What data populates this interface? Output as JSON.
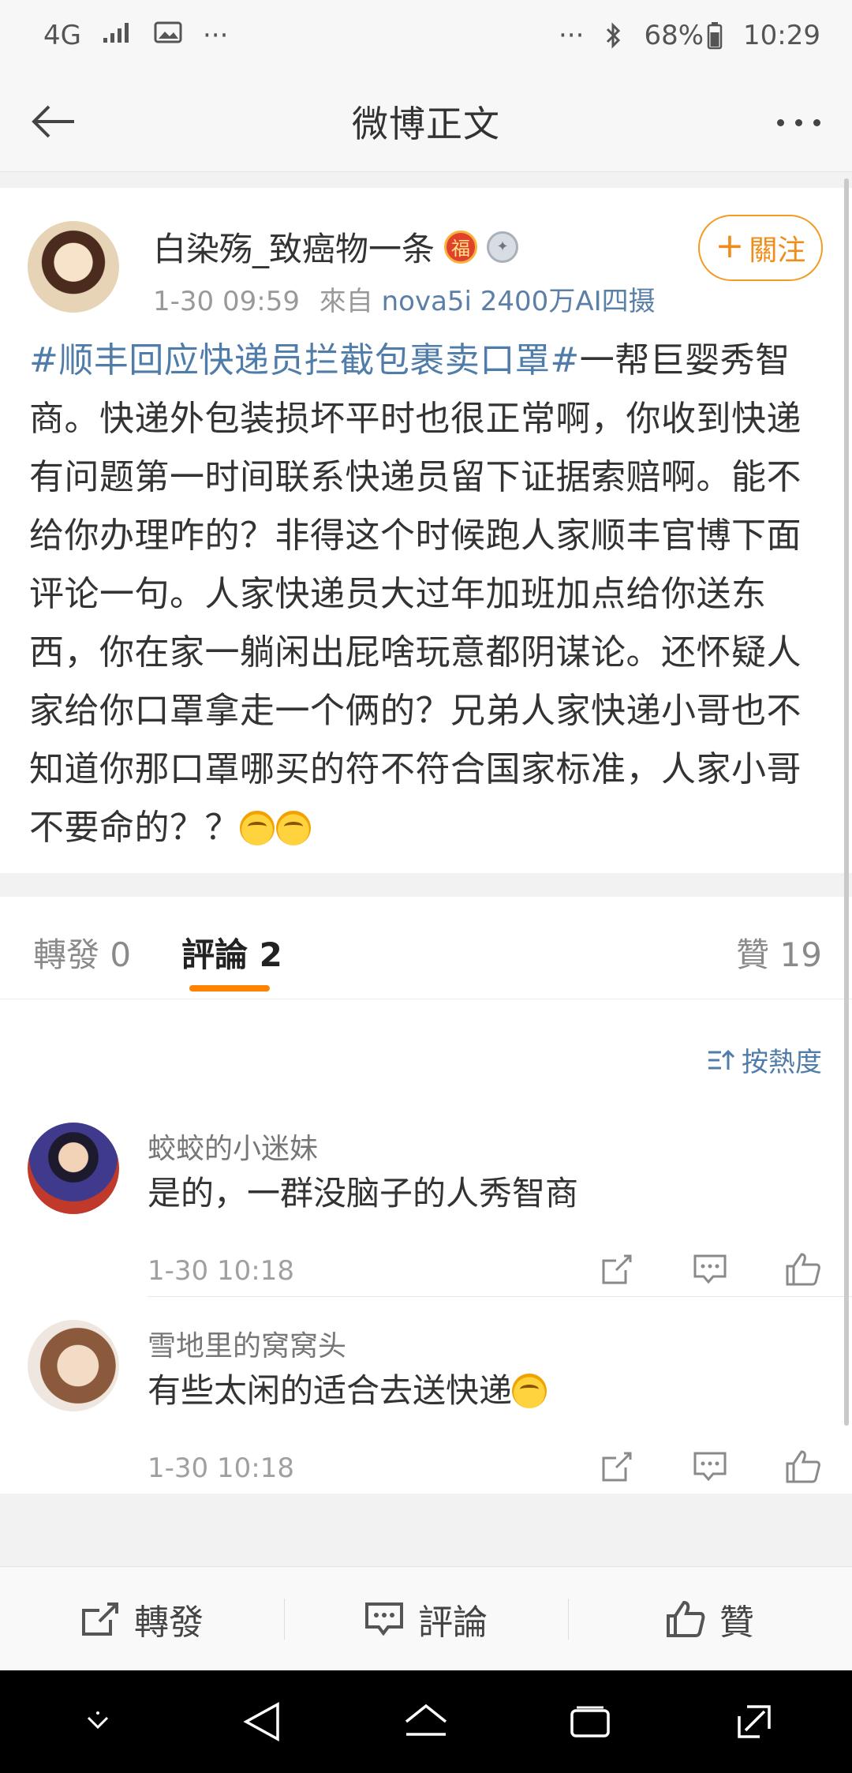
{
  "status_bar": {
    "network": "4G",
    "more": "···",
    "right_more": "···",
    "battery": "68%",
    "time": "10:29"
  },
  "nav": {
    "title": "微博正文"
  },
  "post": {
    "author": "白染殇_致癌物一条",
    "badge_fu": "福",
    "date": "1-30 09:59",
    "source_prefix": "來自",
    "device": "nova5i 2400万AI四摄",
    "follow_label": "關注",
    "hashtag": "#顺丰回应快递员拦截包裹卖口罩#",
    "body": "一帮巨婴秀智商。快递外包装损坏平时也很正常啊，你收到快递有问题第一时间联系快递员留下证据索赔啊。能不给你办理咋的？非得这个时候跑人家顺丰官博下面评论一句。人家快递员大过年加班加点给你送东西，你在家一躺闲出屁啥玩意都阴谋论。还怀疑人家给你口罩拿走一个俩的？兄弟人家快递小哥也不知道你那口罩哪买的符不符合国家标准，人家小哥不要命的？？"
  },
  "tabs": {
    "repost_label": "轉發",
    "repost_count": "0",
    "comment_label": "評論",
    "comment_count": "2",
    "like_label": "贊",
    "like_count": "19"
  },
  "sort_label": "按熱度",
  "comments": [
    {
      "name": "蛟蛟的小迷妹",
      "text": "是的，一群没脑子的人秀智商",
      "time": "1-30 10:18"
    },
    {
      "name": "雪地里的窝窝头",
      "text": "有些太闲的适合去送快递",
      "time": "1-30 10:18"
    }
  ],
  "action_bar": {
    "repost": "轉發",
    "comment": "評論",
    "like": "贊"
  },
  "colors": {
    "accent_orange": "#ff8200",
    "link_blue": "#4f7ca8"
  }
}
